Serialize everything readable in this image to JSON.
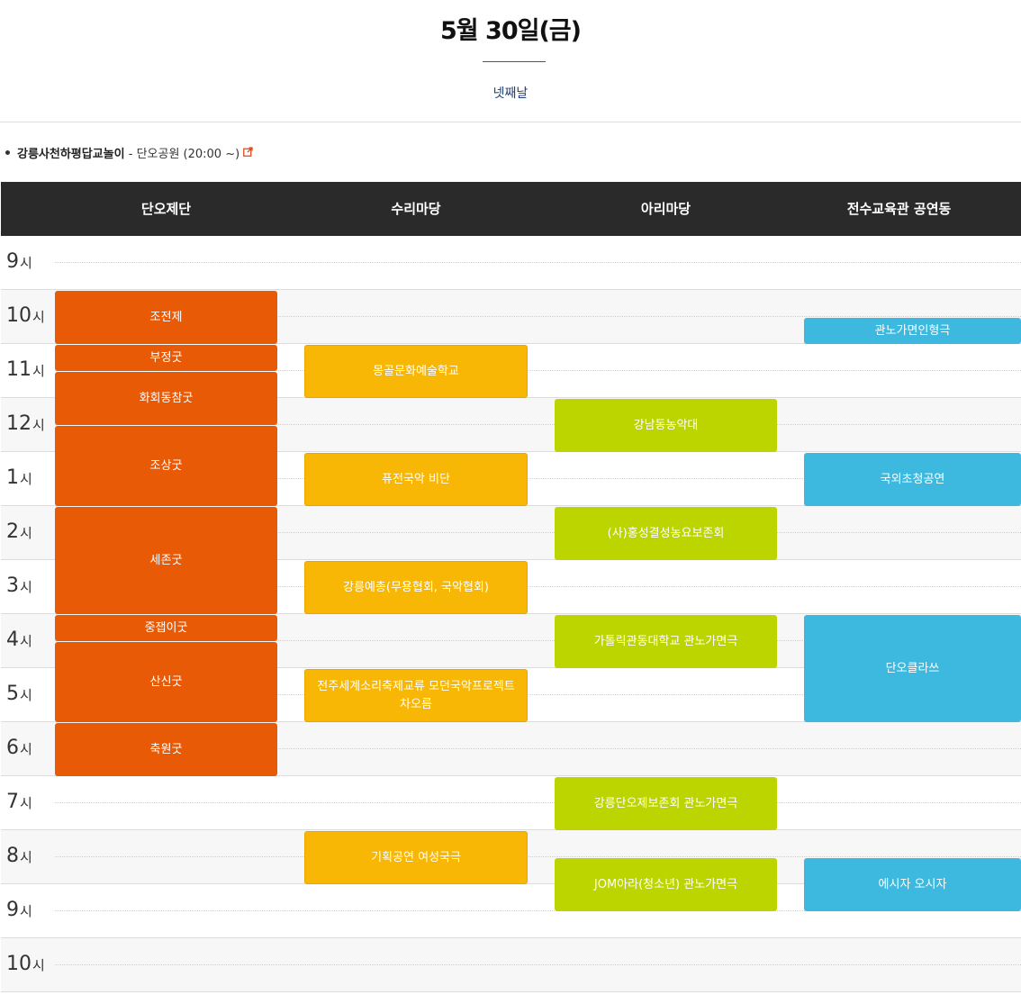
{
  "header": {
    "date_title": "5월 30일(금)",
    "day_label": "넷째날"
  },
  "notice": {
    "event": "강릉사천하평답교놀이",
    "detail": " - 단오공원 (20:00 ~)",
    "icon": "external-link-icon"
  },
  "venues": [
    "단오제단",
    "수리마당",
    "아리마당",
    "전수교육관 공연동"
  ],
  "hours": [
    "9",
    "10",
    "11",
    "12",
    "1",
    "2",
    "3",
    "4",
    "5",
    "6",
    "7",
    "8",
    "9",
    "10"
  ],
  "hour_unit": "시",
  "colors": {
    "venue_1": "#e85a05",
    "venue_2": "#f8b704",
    "venue_3": "#bcd500",
    "venue_4": "#3db9e0",
    "header_bg": "#2a2a2a"
  },
  "events": [
    {
      "venue": 0,
      "title": "조전제",
      "start": "10:00",
      "end": "11:00"
    },
    {
      "venue": 0,
      "title": "부정굿",
      "start": "11:00",
      "end": "11:30"
    },
    {
      "venue": 0,
      "title": "화회동참굿",
      "start": "11:30",
      "end": "12:30"
    },
    {
      "venue": 0,
      "title": "조상굿",
      "start": "12:30",
      "end": "14:00"
    },
    {
      "venue": 0,
      "title": "세존굿",
      "start": "14:00",
      "end": "16:00"
    },
    {
      "venue": 0,
      "title": "중잽이굿",
      "start": "16:00",
      "end": "16:30"
    },
    {
      "venue": 0,
      "title": "산신굿",
      "start": "16:30",
      "end": "18:00"
    },
    {
      "venue": 0,
      "title": "축원굿",
      "start": "18:00",
      "end": "19:00"
    },
    {
      "venue": 1,
      "title": "몽골문화예술학교",
      "start": "11:00",
      "end": "12:00"
    },
    {
      "venue": 1,
      "title": "퓨전국악 비단",
      "start": "13:00",
      "end": "14:00"
    },
    {
      "venue": 1,
      "title": "강릉예총(무용협회, 국악협회)",
      "start": "15:00",
      "end": "16:00"
    },
    {
      "venue": 1,
      "title": "전주세계소리축제교류 모던국악프로젝트 차오름",
      "start": "17:00",
      "end": "18:00"
    },
    {
      "venue": 1,
      "title": "기획공연 여성국극",
      "start": "20:00",
      "end": "21:00"
    },
    {
      "venue": 2,
      "title": "강남동농악대",
      "start": "12:00",
      "end": "13:00"
    },
    {
      "venue": 2,
      "title": "(사)홍성결성농요보존회",
      "start": "14:00",
      "end": "15:00"
    },
    {
      "venue": 2,
      "title": "가톨릭관동대학교 관노가면극",
      "start": "16:00",
      "end": "17:00"
    },
    {
      "venue": 2,
      "title": "강릉단오제보존회 관노가면극",
      "start": "19:00",
      "end": "20:00"
    },
    {
      "venue": 2,
      "title": "JOM아라(청소년) 관노가면극",
      "start": "20:30",
      "end": "21:30"
    },
    {
      "venue": 3,
      "title": "관노가면인형극",
      "start": "10:30",
      "end": "11:00"
    },
    {
      "venue": 3,
      "title": "국외초청공연",
      "start": "13:00",
      "end": "14:00"
    },
    {
      "venue": 3,
      "title": "단오클라쓰",
      "start": "16:00",
      "end": "18:00"
    },
    {
      "venue": 3,
      "title": "에시자 오시자",
      "start": "20:30",
      "end": "21:30"
    }
  ]
}
